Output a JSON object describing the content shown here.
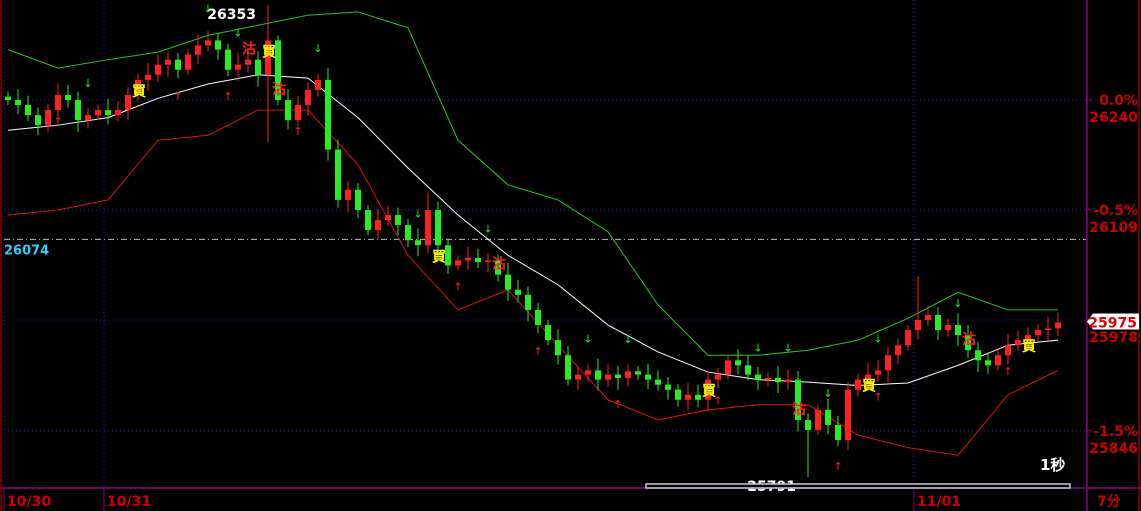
{
  "chart_data": {
    "type": "candlestick",
    "symbol_period": "7分",
    "refresh": "1秒",
    "x_labels": [
      {
        "index": 0,
        "text": "10/30"
      },
      {
        "index": 10,
        "text": "10/31"
      },
      {
        "index": 91,
        "text": "11/01"
      }
    ],
    "y_axis": [
      {
        "price": 26240,
        "pct": "0.0%",
        "label": "26240"
      },
      {
        "price": 26109,
        "pct": "-0.5%",
        "label": "26109"
      },
      {
        "price": 25978,
        "pct": "",
        "label": "25978"
      },
      {
        "price": 25846,
        "pct": "-1.5%",
        "label": "25846"
      }
    ],
    "ylim": [
      25780,
      26360
    ],
    "reference_line": {
      "price": 26074,
      "label": "26074",
      "color": "#33ccff"
    },
    "current_price": {
      "price": 25975,
      "label": "25975"
    },
    "annotations": [
      {
        "index": 26,
        "price": 26353,
        "text": "26353"
      },
      {
        "index": 80,
        "price": 25791,
        "text": "25791"
      }
    ],
    "closes": [
      26240,
      26234,
      26222,
      26210,
      26228,
      26246,
      26240,
      26216,
      26222,
      26228,
      26222,
      26228,
      26246,
      26264,
      26270,
      26282,
      26288,
      26276,
      26294,
      26305,
      26311,
      26300,
      26276,
      26282,
      26288,
      26270,
      26311,
      26240,
      26216,
      26234,
      26252,
      26264,
      26181,
      26121,
      26133,
      26109,
      26085,
      26097,
      26103,
      26091,
      26073,
      26067,
      26109,
      26067,
      26043,
      26049,
      26052,
      26047,
      26049,
      26032,
      26014,
      26008,
      25990,
      25972,
      25954,
      25936,
      25907,
      25913,
      25918,
      25907,
      25913,
      25909,
      25917,
      25913,
      25907,
      25901,
      25895,
      25883,
      25889,
      25883,
      25907,
      25913,
      25930,
      25924,
      25913,
      25907,
      25909,
      25904,
      25907,
      25859,
      25847,
      25871,
      25853,
      25835,
      25895,
      25907,
      25913,
      25918,
      25936,
      25948,
      25966,
      25978,
      25984,
      25966,
      25972,
      25960,
      25942,
      25930,
      25924,
      25936,
      25948,
      25954,
      25960,
      25966,
      25968,
      25975
    ],
    "wick_overrides": [
      {
        "index": 26,
        "high": 26353,
        "low": 26190
      },
      {
        "index": 80,
        "low": 25791
      },
      {
        "index": 91,
        "high": 26030
      },
      {
        "index": 42,
        "high": 26130
      }
    ],
    "band_step": 5,
    "bands": {
      "upper": [
        26300,
        26278,
        26288,
        26297,
        26317,
        26329,
        26341,
        26345,
        26326,
        26192,
        26139,
        26121,
        26083,
        25996,
        25936,
        25936,
        25942,
        25954,
        25980,
        26011,
        25990,
        25990
      ],
      "middle": [
        26204,
        26210,
        26219,
        26242,
        26259,
        26270,
        26266,
        26219,
        26159,
        26103,
        26055,
        26020,
        25972,
        25940,
        25916,
        25907,
        25904,
        25900,
        25903,
        25924,
        25948,
        25954
      ],
      "lower": [
        26103,
        26109,
        26121,
        26192,
        26198,
        26228,
        26228,
        26163,
        26055,
        25990,
        26014,
        25948,
        25883,
        25859,
        25871,
        25877,
        25877,
        25841,
        25826,
        25817,
        25889,
        25918
      ]
    },
    "signals": [
      {
        "index": 13,
        "type": "buy",
        "text": "買"
      },
      {
        "index": 26,
        "type": "buy",
        "text": "買"
      },
      {
        "index": 43,
        "type": "buy",
        "text": "買"
      },
      {
        "index": 70,
        "type": "buy",
        "text": "買"
      },
      {
        "index": 86,
        "type": "buy",
        "text": "買"
      },
      {
        "index": 102,
        "type": "buy",
        "text": "買"
      },
      {
        "index": 24,
        "type": "sell",
        "text": "沽"
      },
      {
        "index": 27,
        "type": "sell",
        "text": "沽"
      },
      {
        "index": 49,
        "type": "sell",
        "text": "沽"
      },
      {
        "index": 79,
        "type": "sell",
        "text": "沽"
      },
      {
        "index": 96,
        "type": "sell",
        "text": "沽"
      }
    ],
    "arrows_down": [
      8,
      20,
      23,
      31,
      41,
      48,
      58,
      62,
      75,
      78,
      82,
      87,
      95
    ],
    "arrows_up": [
      5,
      17,
      22,
      29,
      45,
      53,
      61,
      71,
      83,
      87,
      100
    ]
  },
  "colors": {
    "up": "#ff2020",
    "down": "#22ee22",
    "upper": "#22cc22",
    "middle": "#ffffff",
    "lower": "#dd1111",
    "axis": "#cc0000",
    "frame": "#880088",
    "grid": "#1a1acc"
  }
}
